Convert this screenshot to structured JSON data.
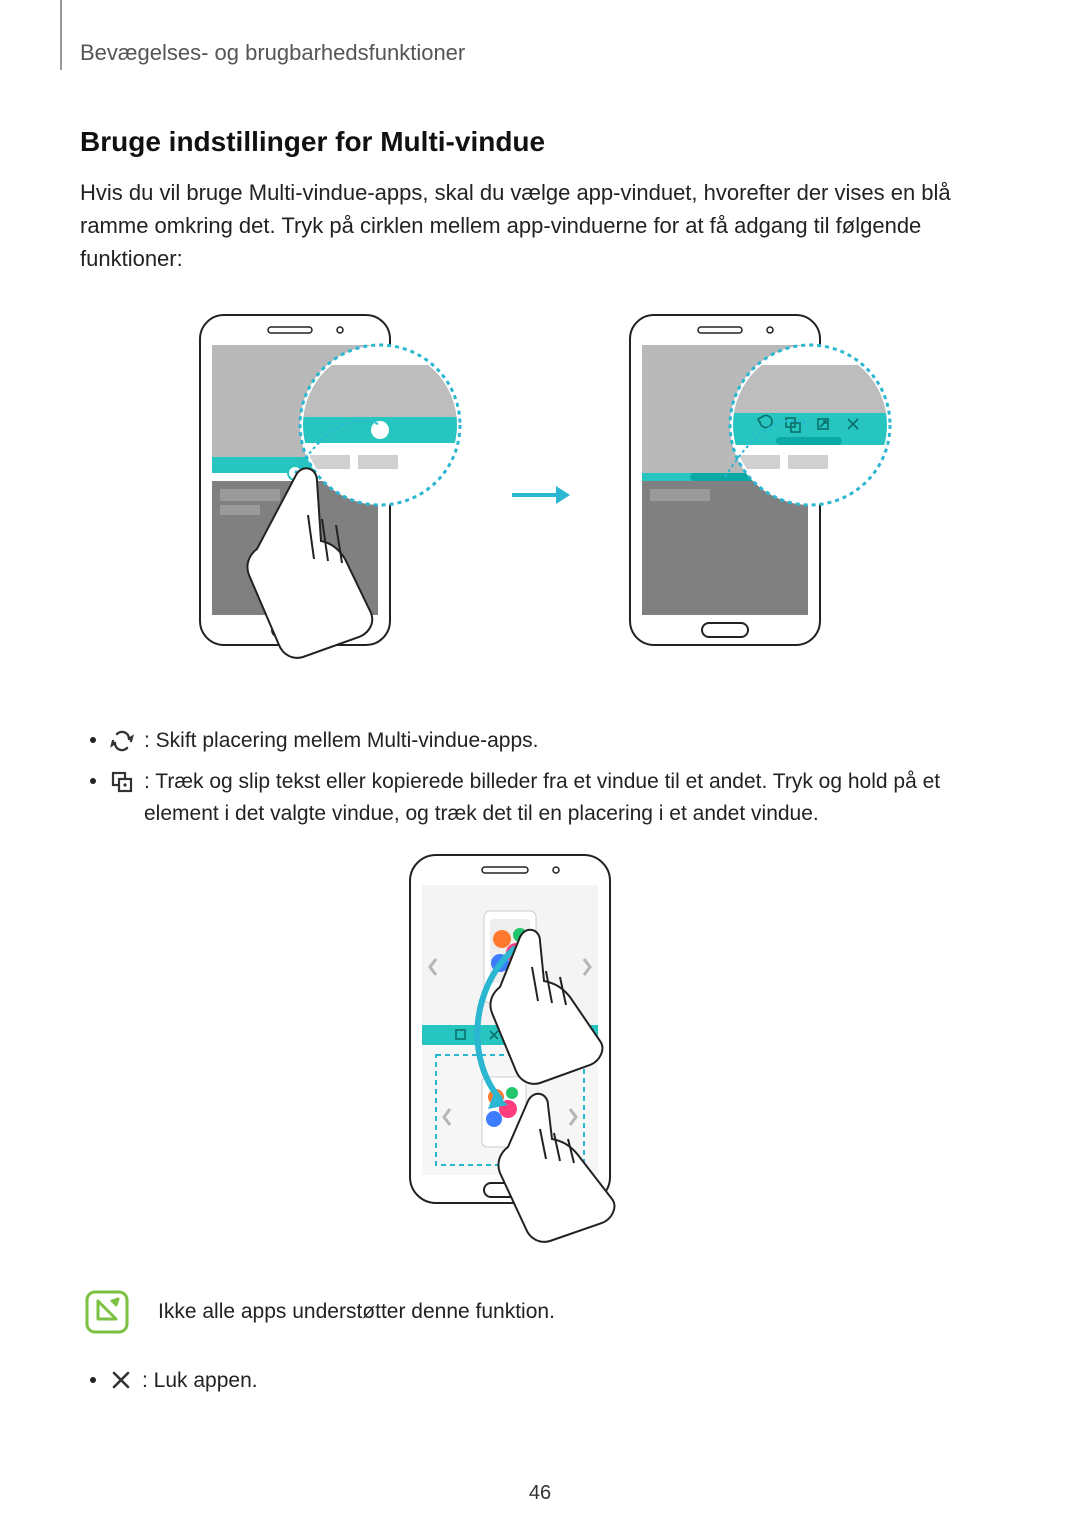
{
  "breadcrumb": "Bevægelses- og brugbarhedsfunktioner",
  "section_title": "Bruge indstillinger for Multi-vindue",
  "intro": "Hvis du vil bruge Multi-vindue-apps, skal du vælge app-vinduet, hvorefter der vises en blå ramme omkring det. Tryk på cirklen mellem app-vinduerne for at få adgang til følgende funktioner:",
  "bullets": {
    "swap": " : Skift placering mellem Multi-vindue-apps.",
    "drag": " : Træk og slip tekst eller kopierede billeder fra et vindue til et andet. Tryk og hold på et element i det valgte vindue, og træk det til en placering i et andet vindue.",
    "close": " : Luk appen."
  },
  "note": "Ikke alle apps understøtter denne funktion.",
  "page_number": "46",
  "colors": {
    "teal": "#26c5c0",
    "cyan": "#2bb6d1",
    "note_green": "#7bc142"
  }
}
